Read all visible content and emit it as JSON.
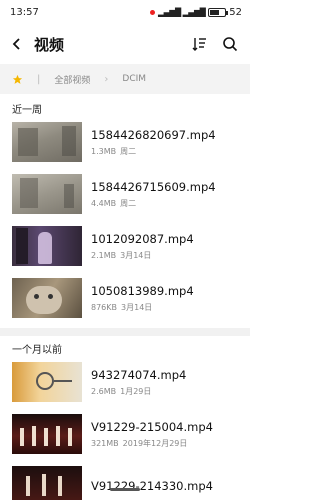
{
  "status_bar": {
    "time": "13:57",
    "signal": "❘il ❘il",
    "battery": "52"
  },
  "toolbar": {
    "title": "视频",
    "back_icon": "back-arrow-icon",
    "sort_icon": "sort-icon",
    "search_icon": "search-icon"
  },
  "breadcrumb": {
    "items": [
      "全部视频",
      "DCIM"
    ]
  },
  "sections": [
    {
      "label": "近一周"
    },
    {
      "label": "一个月以前"
    }
  ],
  "files": [
    {
      "name": "1584426820697.mp4",
      "size": "1.3MB",
      "date": "周二"
    },
    {
      "name": "1584426715609.mp4",
      "size": "4.4MB",
      "date": "周二"
    },
    {
      "name": "1012092087.mp4",
      "size": "2.1MB",
      "date": "3月14日"
    },
    {
      "name": "1050813989.mp4",
      "size": "876KB",
      "date": "3月14日"
    },
    {
      "name": "943274074.mp4",
      "size": "2.6MB",
      "date": "1月29日"
    },
    {
      "name": "V91229-215004.mp4",
      "size": "321MB",
      "date": "2019年12月29日"
    },
    {
      "name": "V91229-214330.mp4",
      "size": "",
      "date": ""
    }
  ],
  "colors": {
    "accent_star": "#f5b700",
    "background_strip": "#f3f3f3"
  }
}
